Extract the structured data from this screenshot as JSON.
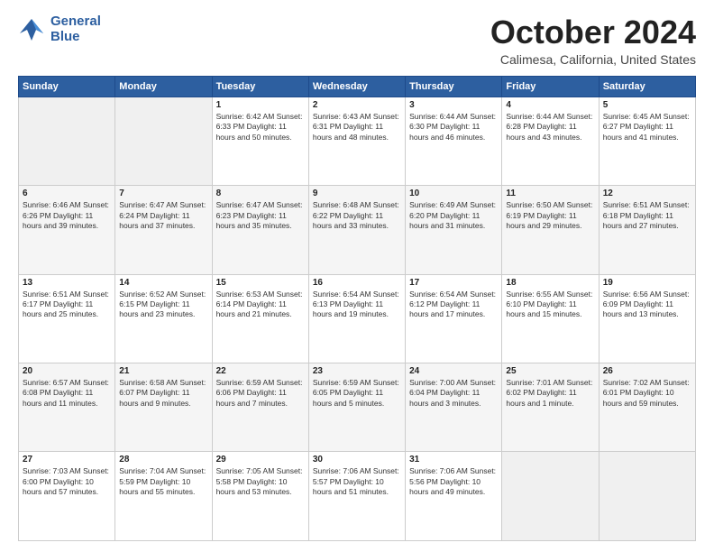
{
  "logo": {
    "line1": "General",
    "line2": "Blue"
  },
  "title": "October 2024",
  "subtitle": "Calimesa, California, United States",
  "days_of_week": [
    "Sunday",
    "Monday",
    "Tuesday",
    "Wednesday",
    "Thursday",
    "Friday",
    "Saturday"
  ],
  "weeks": [
    [
      {
        "num": "",
        "info": ""
      },
      {
        "num": "",
        "info": ""
      },
      {
        "num": "1",
        "info": "Sunrise: 6:42 AM\nSunset: 6:33 PM\nDaylight: 11 hours and 50 minutes."
      },
      {
        "num": "2",
        "info": "Sunrise: 6:43 AM\nSunset: 6:31 PM\nDaylight: 11 hours and 48 minutes."
      },
      {
        "num": "3",
        "info": "Sunrise: 6:44 AM\nSunset: 6:30 PM\nDaylight: 11 hours and 46 minutes."
      },
      {
        "num": "4",
        "info": "Sunrise: 6:44 AM\nSunset: 6:28 PM\nDaylight: 11 hours and 43 minutes."
      },
      {
        "num": "5",
        "info": "Sunrise: 6:45 AM\nSunset: 6:27 PM\nDaylight: 11 hours and 41 minutes."
      }
    ],
    [
      {
        "num": "6",
        "info": "Sunrise: 6:46 AM\nSunset: 6:26 PM\nDaylight: 11 hours and 39 minutes."
      },
      {
        "num": "7",
        "info": "Sunrise: 6:47 AM\nSunset: 6:24 PM\nDaylight: 11 hours and 37 minutes."
      },
      {
        "num": "8",
        "info": "Sunrise: 6:47 AM\nSunset: 6:23 PM\nDaylight: 11 hours and 35 minutes."
      },
      {
        "num": "9",
        "info": "Sunrise: 6:48 AM\nSunset: 6:22 PM\nDaylight: 11 hours and 33 minutes."
      },
      {
        "num": "10",
        "info": "Sunrise: 6:49 AM\nSunset: 6:20 PM\nDaylight: 11 hours and 31 minutes."
      },
      {
        "num": "11",
        "info": "Sunrise: 6:50 AM\nSunset: 6:19 PM\nDaylight: 11 hours and 29 minutes."
      },
      {
        "num": "12",
        "info": "Sunrise: 6:51 AM\nSunset: 6:18 PM\nDaylight: 11 hours and 27 minutes."
      }
    ],
    [
      {
        "num": "13",
        "info": "Sunrise: 6:51 AM\nSunset: 6:17 PM\nDaylight: 11 hours and 25 minutes."
      },
      {
        "num": "14",
        "info": "Sunrise: 6:52 AM\nSunset: 6:15 PM\nDaylight: 11 hours and 23 minutes."
      },
      {
        "num": "15",
        "info": "Sunrise: 6:53 AM\nSunset: 6:14 PM\nDaylight: 11 hours and 21 minutes."
      },
      {
        "num": "16",
        "info": "Sunrise: 6:54 AM\nSunset: 6:13 PM\nDaylight: 11 hours and 19 minutes."
      },
      {
        "num": "17",
        "info": "Sunrise: 6:54 AM\nSunset: 6:12 PM\nDaylight: 11 hours and 17 minutes."
      },
      {
        "num": "18",
        "info": "Sunrise: 6:55 AM\nSunset: 6:10 PM\nDaylight: 11 hours and 15 minutes."
      },
      {
        "num": "19",
        "info": "Sunrise: 6:56 AM\nSunset: 6:09 PM\nDaylight: 11 hours and 13 minutes."
      }
    ],
    [
      {
        "num": "20",
        "info": "Sunrise: 6:57 AM\nSunset: 6:08 PM\nDaylight: 11 hours and 11 minutes."
      },
      {
        "num": "21",
        "info": "Sunrise: 6:58 AM\nSunset: 6:07 PM\nDaylight: 11 hours and 9 minutes."
      },
      {
        "num": "22",
        "info": "Sunrise: 6:59 AM\nSunset: 6:06 PM\nDaylight: 11 hours and 7 minutes."
      },
      {
        "num": "23",
        "info": "Sunrise: 6:59 AM\nSunset: 6:05 PM\nDaylight: 11 hours and 5 minutes."
      },
      {
        "num": "24",
        "info": "Sunrise: 7:00 AM\nSunset: 6:04 PM\nDaylight: 11 hours and 3 minutes."
      },
      {
        "num": "25",
        "info": "Sunrise: 7:01 AM\nSunset: 6:02 PM\nDaylight: 11 hours and 1 minute."
      },
      {
        "num": "26",
        "info": "Sunrise: 7:02 AM\nSunset: 6:01 PM\nDaylight: 10 hours and 59 minutes."
      }
    ],
    [
      {
        "num": "27",
        "info": "Sunrise: 7:03 AM\nSunset: 6:00 PM\nDaylight: 10 hours and 57 minutes."
      },
      {
        "num": "28",
        "info": "Sunrise: 7:04 AM\nSunset: 5:59 PM\nDaylight: 10 hours and 55 minutes."
      },
      {
        "num": "29",
        "info": "Sunrise: 7:05 AM\nSunset: 5:58 PM\nDaylight: 10 hours and 53 minutes."
      },
      {
        "num": "30",
        "info": "Sunrise: 7:06 AM\nSunset: 5:57 PM\nDaylight: 10 hours and 51 minutes."
      },
      {
        "num": "31",
        "info": "Sunrise: 7:06 AM\nSunset: 5:56 PM\nDaylight: 10 hours and 49 minutes."
      },
      {
        "num": "",
        "info": ""
      },
      {
        "num": "",
        "info": ""
      }
    ]
  ]
}
